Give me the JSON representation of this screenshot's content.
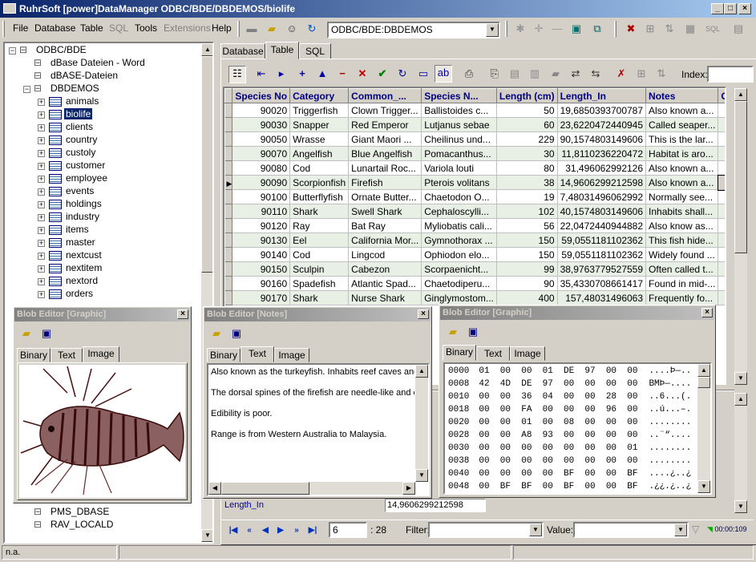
{
  "window": {
    "title": "RuhrSoft [power]DataManager ODBC/BDE/DBDEMOS/biolife"
  },
  "menu": [
    "File",
    "Database",
    "Table",
    "SQL",
    "Tools",
    "Extensions",
    "Help"
  ],
  "toolbar": {
    "alias_combo": "ODBC/BDE:DBDEMOS"
  },
  "tree": {
    "root": "ODBC/BDE",
    "items": [
      "dBase Dateien - Word",
      "dBASE-Dateien",
      "DBDEMOS"
    ],
    "tables": [
      "animals",
      "biolife",
      "clients",
      "country",
      "custoly",
      "customer",
      "employee",
      "events",
      "holdings",
      "industry",
      "items",
      "master",
      "nextcust",
      "nextitem",
      "nextord",
      "orders"
    ],
    "bottom_items": [
      "PMS_DBASE",
      "RAV_LOCALD"
    ],
    "selected": "biolife"
  },
  "tabs": {
    "top": [
      "Database",
      "Table",
      "SQL"
    ],
    "active": "Table"
  },
  "index_label": "Index:",
  "grid": {
    "columns": [
      "Species No",
      "Category",
      "Common_...",
      "Species N...",
      "Length (cm)",
      "Length_In",
      "Notes",
      "Graphic"
    ],
    "rows": [
      [
        "90020",
        "Triggerfish",
        "Clown Trigger...",
        "Ballistoides c...",
        "50",
        "19,6850393700787",
        "Also known a...",
        ""
      ],
      [
        "90030",
        "Snapper",
        "Red Emperor",
        "Lutjanus sebae",
        "60",
        "23,6220472440945",
        "Called seaper...",
        ""
      ],
      [
        "90050",
        "Wrasse",
        "Giant Maori ...",
        "Cheilinus und...",
        "229",
        "90,1574803149606",
        "This is the lar...",
        ""
      ],
      [
        "90070",
        "Angelfish",
        "Blue Angelfish",
        "Pomacanthus...",
        "30",
        "11,8110236220472",
        "Habitat is aro...",
        ""
      ],
      [
        "90080",
        "Cod",
        "Lunartail Roc...",
        "Variola louti",
        "80",
        "31,496062992126",
        "Also known a...",
        ""
      ],
      [
        "90090",
        "Scorpionfish",
        "Firefish",
        "Pterois volitans",
        "38",
        "14,9606299212598",
        "Also known a...",
        ""
      ],
      [
        "90100",
        "Butterflyfish",
        "Ornate Butter...",
        "Chaetodon O...",
        "19",
        "7,48031496062992",
        "Normally see...",
        ""
      ],
      [
        "90110",
        "Shark",
        "Swell Shark",
        "Cephaloscylli...",
        "102",
        "40,1574803149606",
        "Inhabits shall...",
        ""
      ],
      [
        "90120",
        "Ray",
        "Bat Ray",
        "Myliobatis cali...",
        "56",
        "22,0472440944882",
        "Also know as...",
        ""
      ],
      [
        "90130",
        "Eel",
        "California Mor...",
        "Gymnothorax ...",
        "150",
        "59,0551181102362",
        "This fish hide...",
        ""
      ],
      [
        "90140",
        "Cod",
        "Lingcod",
        "Ophiodon elo...",
        "150",
        "59,0551181102362",
        "Widely found ...",
        ""
      ],
      [
        "90150",
        "Sculpin",
        "Cabezon",
        "Scorpaenicht...",
        "99",
        "38,9763779527559",
        "Often called t...",
        ""
      ],
      [
        "90160",
        "Spadefish",
        "Atlantic Spad...",
        "Chaetodiperu...",
        "90",
        "35,4330708661417",
        "Found in mid-...",
        ""
      ],
      [
        "90170",
        "Shark",
        "Nurse Shark",
        "Ginglymostom...",
        "400",
        "157,48031496063",
        "Frequently fo...",
        ""
      ]
    ],
    "current_row": 5
  },
  "blob_graphic": {
    "title": "Blob Editor [Graphic]",
    "tabs": [
      "Binary",
      "Text",
      "Image"
    ],
    "active": "Image"
  },
  "blob_notes": {
    "title": "Blob Editor [Notes]",
    "tabs": [
      "Binary",
      "Text",
      "Image"
    ],
    "active": "Text",
    "lines": [
      "Also known as the turkeyfish.  Inhabits reef caves and",
      "",
      "The dorsal spines of the firefish are needle-like and co",
      "",
      "Edibility is poor.",
      "",
      "Range is from Western Australia to Malaysia."
    ]
  },
  "blob_hex": {
    "title": "Blob Editor [Graphic]",
    "tabs": [
      "Binary",
      "Text",
      "Image"
    ],
    "active": "Binary",
    "lines": [
      {
        "off": "0000",
        "bytes": "01  00  00  01  DE  97  00  00",
        "ascii": "....Þ—.."
      },
      {
        "off": "0008",
        "bytes": "42  4D  DE  97  00  00  00  00",
        "ascii": "BMÞ—...."
      },
      {
        "off": "0010",
        "bytes": "00  00  36  04  00  00  28  00",
        "ascii": "..6...(."
      },
      {
        "off": "0018",
        "bytes": "00  00  FA  00  00  00  96  00",
        "ascii": "..ú...–."
      },
      {
        "off": "0020",
        "bytes": "00  00  01  00  08  00  00  00",
        "ascii": "........"
      },
      {
        "off": "0028",
        "bytes": "00  00  A8  93  00  00  00  00",
        "ascii": "..¨“...."
      },
      {
        "off": "0030",
        "bytes": "00  00  00  00  00  00  00  01",
        "ascii": "........"
      },
      {
        "off": "0038",
        "bytes": "00  00  00  00  00  00  00  00",
        "ascii": "........"
      },
      {
        "off": "0040",
        "bytes": "00  00  00  00  BF  00  00  BF",
        "ascii": "....¿..¿"
      },
      {
        "off": "0048",
        "bytes": "00  BF  BF  00  BF  00  00  BF",
        "ascii": ".¿¿.¿..¿"
      }
    ]
  },
  "detail": {
    "label": "Length_In",
    "value": "14,9606299212598"
  },
  "nav": {
    "record": "6",
    "count": ": 28",
    "filter_label": "Filter:",
    "value_label": "Value:",
    "timer": "00:00:109"
  },
  "status": {
    "left": "n.a."
  }
}
